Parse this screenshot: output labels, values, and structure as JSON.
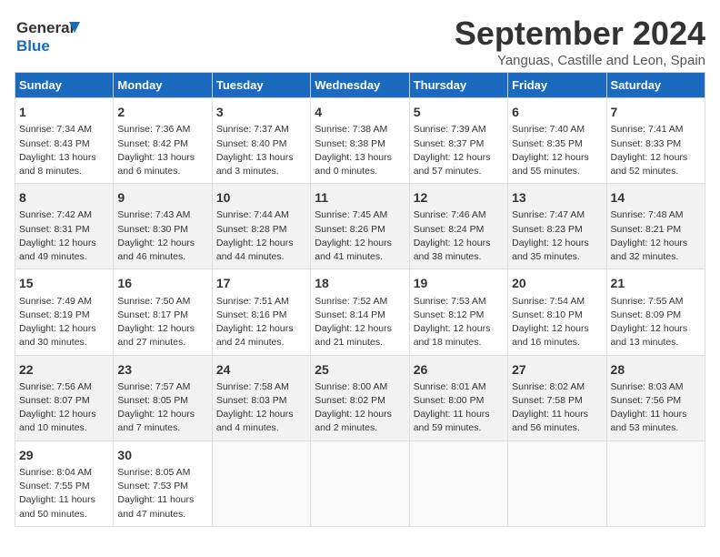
{
  "logo": {
    "line1": "General",
    "line2": "Blue"
  },
  "title": "September 2024",
  "subtitle": "Yanguas, Castille and Leon, Spain",
  "headers": [
    "Sunday",
    "Monday",
    "Tuesday",
    "Wednesday",
    "Thursday",
    "Friday",
    "Saturday"
  ],
  "weeks": [
    [
      {
        "day": "1",
        "sunrise": "7:34 AM",
        "sunset": "8:43 PM",
        "daylight": "13 hours and 8 minutes."
      },
      {
        "day": "2",
        "sunrise": "7:36 AM",
        "sunset": "8:42 PM",
        "daylight": "13 hours and 6 minutes."
      },
      {
        "day": "3",
        "sunrise": "7:37 AM",
        "sunset": "8:40 PM",
        "daylight": "13 hours and 3 minutes."
      },
      {
        "day": "4",
        "sunrise": "7:38 AM",
        "sunset": "8:38 PM",
        "daylight": "13 hours and 0 minutes."
      },
      {
        "day": "5",
        "sunrise": "7:39 AM",
        "sunset": "8:37 PM",
        "daylight": "12 hours and 57 minutes."
      },
      {
        "day": "6",
        "sunrise": "7:40 AM",
        "sunset": "8:35 PM",
        "daylight": "12 hours and 55 minutes."
      },
      {
        "day": "7",
        "sunrise": "7:41 AM",
        "sunset": "8:33 PM",
        "daylight": "12 hours and 52 minutes."
      }
    ],
    [
      {
        "day": "8",
        "sunrise": "7:42 AM",
        "sunset": "8:31 PM",
        "daylight": "12 hours and 49 minutes."
      },
      {
        "day": "9",
        "sunrise": "7:43 AM",
        "sunset": "8:30 PM",
        "daylight": "12 hours and 46 minutes."
      },
      {
        "day": "10",
        "sunrise": "7:44 AM",
        "sunset": "8:28 PM",
        "daylight": "12 hours and 44 minutes."
      },
      {
        "day": "11",
        "sunrise": "7:45 AM",
        "sunset": "8:26 PM",
        "daylight": "12 hours and 41 minutes."
      },
      {
        "day": "12",
        "sunrise": "7:46 AM",
        "sunset": "8:24 PM",
        "daylight": "12 hours and 38 minutes."
      },
      {
        "day": "13",
        "sunrise": "7:47 AM",
        "sunset": "8:23 PM",
        "daylight": "12 hours and 35 minutes."
      },
      {
        "day": "14",
        "sunrise": "7:48 AM",
        "sunset": "8:21 PM",
        "daylight": "12 hours and 32 minutes."
      }
    ],
    [
      {
        "day": "15",
        "sunrise": "7:49 AM",
        "sunset": "8:19 PM",
        "daylight": "12 hours and 30 minutes."
      },
      {
        "day": "16",
        "sunrise": "7:50 AM",
        "sunset": "8:17 PM",
        "daylight": "12 hours and 27 minutes."
      },
      {
        "day": "17",
        "sunrise": "7:51 AM",
        "sunset": "8:16 PM",
        "daylight": "12 hours and 24 minutes."
      },
      {
        "day": "18",
        "sunrise": "7:52 AM",
        "sunset": "8:14 PM",
        "daylight": "12 hours and 21 minutes."
      },
      {
        "day": "19",
        "sunrise": "7:53 AM",
        "sunset": "8:12 PM",
        "daylight": "12 hours and 18 minutes."
      },
      {
        "day": "20",
        "sunrise": "7:54 AM",
        "sunset": "8:10 PM",
        "daylight": "12 hours and 16 minutes."
      },
      {
        "day": "21",
        "sunrise": "7:55 AM",
        "sunset": "8:09 PM",
        "daylight": "12 hours and 13 minutes."
      }
    ],
    [
      {
        "day": "22",
        "sunrise": "7:56 AM",
        "sunset": "8:07 PM",
        "daylight": "12 hours and 10 minutes."
      },
      {
        "day": "23",
        "sunrise": "7:57 AM",
        "sunset": "8:05 PM",
        "daylight": "12 hours and 7 minutes."
      },
      {
        "day": "24",
        "sunrise": "7:58 AM",
        "sunset": "8:03 PM",
        "daylight": "12 hours and 4 minutes."
      },
      {
        "day": "25",
        "sunrise": "8:00 AM",
        "sunset": "8:02 PM",
        "daylight": "12 hours and 2 minutes."
      },
      {
        "day": "26",
        "sunrise": "8:01 AM",
        "sunset": "8:00 PM",
        "daylight": "11 hours and 59 minutes."
      },
      {
        "day": "27",
        "sunrise": "8:02 AM",
        "sunset": "7:58 PM",
        "daylight": "11 hours and 56 minutes."
      },
      {
        "day": "28",
        "sunrise": "8:03 AM",
        "sunset": "7:56 PM",
        "daylight": "11 hours and 53 minutes."
      }
    ],
    [
      {
        "day": "29",
        "sunrise": "8:04 AM",
        "sunset": "7:55 PM",
        "daylight": "11 hours and 50 minutes."
      },
      {
        "day": "30",
        "sunrise": "8:05 AM",
        "sunset": "7:53 PM",
        "daylight": "11 hours and 47 minutes."
      },
      null,
      null,
      null,
      null,
      null
    ]
  ]
}
